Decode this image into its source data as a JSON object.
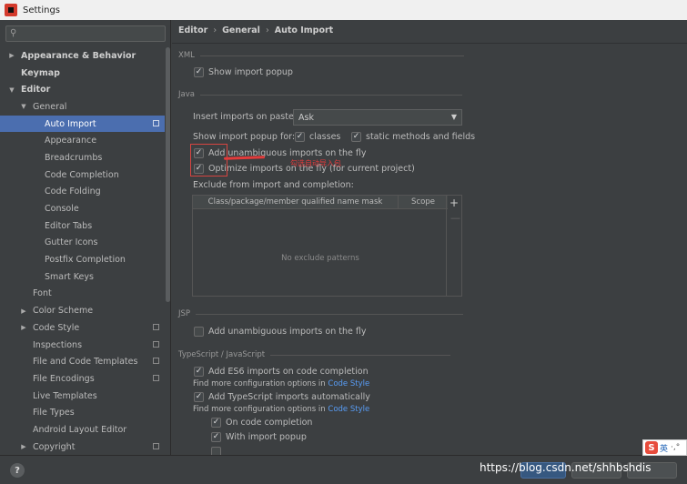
{
  "window": {
    "title": "Settings"
  },
  "search": {
    "placeholder": ""
  },
  "tree": [
    {
      "label": "Appearance & Behavior",
      "level": 0,
      "arrow": "▶",
      "bold": true
    },
    {
      "label": "Keymap",
      "level": 0,
      "arrow": "",
      "bold": true
    },
    {
      "label": "Editor",
      "level": 0,
      "arrow": "▼",
      "bold": true
    },
    {
      "label": "General",
      "level": 1,
      "arrow": "▼"
    },
    {
      "label": "Auto Import",
      "level": 2,
      "arrow": "",
      "selected": true,
      "proj": true
    },
    {
      "label": "Appearance",
      "level": 2,
      "arrow": ""
    },
    {
      "label": "Breadcrumbs",
      "level": 2,
      "arrow": ""
    },
    {
      "label": "Code Completion",
      "level": 2,
      "arrow": ""
    },
    {
      "label": "Code Folding",
      "level": 2,
      "arrow": ""
    },
    {
      "label": "Console",
      "level": 2,
      "arrow": ""
    },
    {
      "label": "Editor Tabs",
      "level": 2,
      "arrow": ""
    },
    {
      "label": "Gutter Icons",
      "level": 2,
      "arrow": ""
    },
    {
      "label": "Postfix Completion",
      "level": 2,
      "arrow": ""
    },
    {
      "label": "Smart Keys",
      "level": 2,
      "arrow": ""
    },
    {
      "label": "Font",
      "level": 1,
      "arrow": ""
    },
    {
      "label": "Color Scheme",
      "level": 1,
      "arrow": "▶"
    },
    {
      "label": "Code Style",
      "level": 1,
      "arrow": "▶",
      "proj": true
    },
    {
      "label": "Inspections",
      "level": 1,
      "arrow": "",
      "proj": true
    },
    {
      "label": "File and Code Templates",
      "level": 1,
      "arrow": "",
      "proj": true
    },
    {
      "label": "File Encodings",
      "level": 1,
      "arrow": "",
      "proj": true
    },
    {
      "label": "Live Templates",
      "level": 1,
      "arrow": ""
    },
    {
      "label": "File Types",
      "level": 1,
      "arrow": ""
    },
    {
      "label": "Android Layout Editor",
      "level": 1,
      "arrow": ""
    },
    {
      "label": "Copyright",
      "level": 1,
      "arrow": "▶",
      "proj": true
    }
  ],
  "breadcrumb": {
    "a": "Editor",
    "b": "General",
    "c": "Auto Import",
    "sep": "›"
  },
  "xml": {
    "section": "XML",
    "show_popup": "Show import popup"
  },
  "java": {
    "section": "Java",
    "insert_label": "Insert imports on paste:",
    "insert_value": "Ask",
    "popup_for_label": "Show import popup for:",
    "classes": "classes",
    "static_methods": "static methods and fields",
    "add_unambiguous": "Add unambiguous imports on the fly",
    "optimize": "Optimize imports on the fly (for current project)",
    "exclude_label": "Exclude from import and completion:",
    "col_mask": "Class/package/member qualified name mask",
    "col_scope": "Scope",
    "empty": "No exclude patterns",
    "plus": "+",
    "minus": "—"
  },
  "annotation": {
    "text": "勾选自动导入包"
  },
  "jsp": {
    "section": "JSP",
    "add_unambiguous": "Add unambiguous imports on the fly"
  },
  "ts": {
    "section": "TypeScript / JavaScript",
    "es6": "Add ES6 imports on code completion",
    "find_more": "Find more configuration options in",
    "code_style": "Code Style",
    "ts_auto": "Add TypeScript imports automatically",
    "on_completion": "On code completion",
    "with_popup": "With import popup"
  },
  "footer": {
    "help": "?",
    "watermark": "https://blog.csdn.net/shhbshdis"
  },
  "ime": {
    "logo": "S",
    "lang": "英",
    "extra": "·,°"
  }
}
